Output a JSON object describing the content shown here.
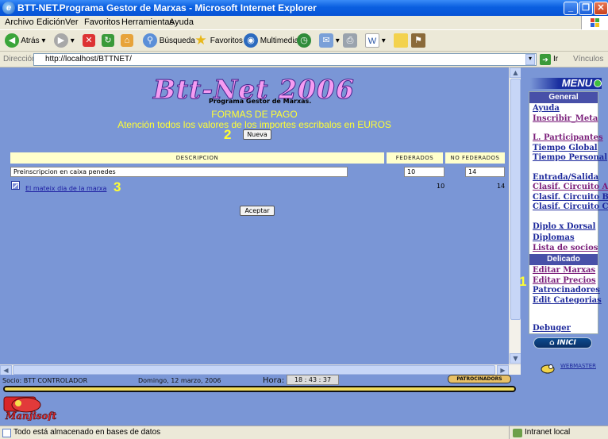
{
  "window": {
    "title": "BTT-NET.Programa Gestor de Marxas - Microsoft Internet Explorer",
    "minimize": "_",
    "maximize": "❐",
    "close": "✕"
  },
  "menubar": [
    "Archivo",
    "Edición",
    "Ver",
    "Favoritos",
    "Herramientas",
    "Ayuda"
  ],
  "toolbar": {
    "back": "Atrás",
    "search": "Búsqueda",
    "favorites": "Favoritos",
    "multimedia": "Multimedia"
  },
  "address": {
    "label": "Dirección",
    "url": "http://localhost/BTTNET/",
    "go": "Ir",
    "links": "Vínculos"
  },
  "page": {
    "logo": "Btt-Net 2006",
    "subtitle": "Programa Gestor de Marxas.",
    "heading": "FORMAS DE PAGO",
    "notice": "Atención todos los valores de los importes escribalos en EUROS",
    "new_button": "Nueva",
    "accept_button": "Aceptar",
    "markers": {
      "m1": "1",
      "m2": "2",
      "m3": "3"
    },
    "table": {
      "headers": [
        "DESCRIPCION",
        "FEDERADOS",
        "NO FEDERADOS"
      ],
      "edit_row": {
        "description": "Preinscripcion en caixa penedes",
        "federados": "10",
        "no_federados": "14"
      },
      "list_row": {
        "description": "El mateix dia de la marxa",
        "federados": "10",
        "no_federados": "14"
      }
    }
  },
  "right_menu": {
    "title": "MENU",
    "general_header": "General",
    "general": [
      "Ayuda",
      "Inscribir_Meta",
      "L. Participantes",
      "Tiempo Global",
      "Tiempo Personal",
      "Entrada/Salida",
      "Clasif. Circuito A",
      "Clasif. Circuito B",
      "Clasif. Circuito C",
      "Diplo x Dorsal",
      "Diplomas",
      "Lista de socios"
    ],
    "delicado_header": "Delicado",
    "delicado": [
      "Editar Marxas",
      "Editar Precios",
      "Patrocinadores",
      "Edit Categorias"
    ],
    "debuger": "Debuger",
    "inici": "INICI",
    "webmaster": "WEBMASTER"
  },
  "infobar": {
    "user": "Socio: BTT    CONTROLADOR",
    "date": "Domingo, 12 marzo, 2006",
    "hora_label": "Hora:",
    "hora_value": "18 : 43 : 37",
    "patrocinadores": "PATROCINADORS"
  },
  "footer_logo": "Manjisoft",
  "status": {
    "text": "Todo está almacenado en bases de datos",
    "zone": "Intranet local"
  }
}
